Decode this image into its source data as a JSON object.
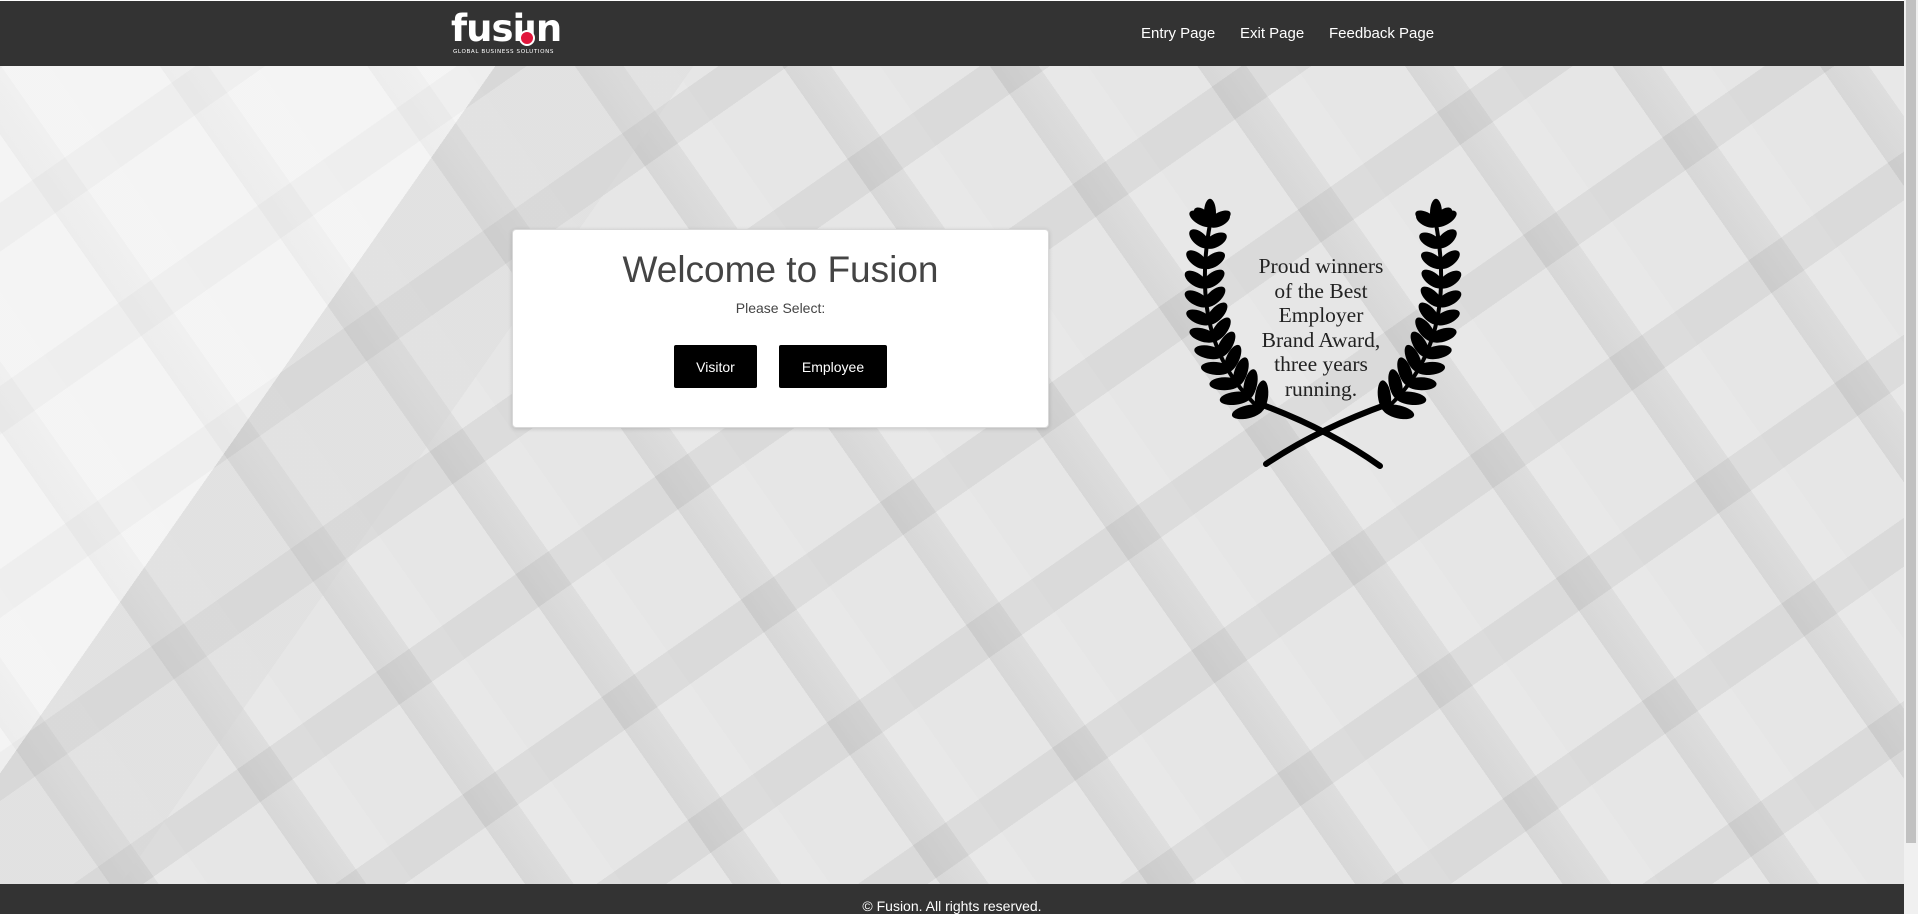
{
  "header": {
    "logo_word": "fusiın",
    "logo_tagline": "GLOBAL BUSINESS SOLUTIONS",
    "nav": {
      "entry": "Entry Page",
      "exit": "Exit Page",
      "feedback": "Feedback Page"
    }
  },
  "card": {
    "title": "Welcome to Fusion",
    "subtitle": "Please Select:",
    "visitor_label": "Visitor",
    "employee_label": "Employee"
  },
  "award": {
    "lines": [
      "Proud winners",
      "of the Best",
      "Employer",
      "Brand Award,",
      "three years",
      "running."
    ]
  },
  "footer": {
    "text": "© Fusion. All rights reserved."
  },
  "colors": {
    "header_bg": "#333333",
    "accent_red": "#e1163c",
    "button_bg": "#000000"
  }
}
